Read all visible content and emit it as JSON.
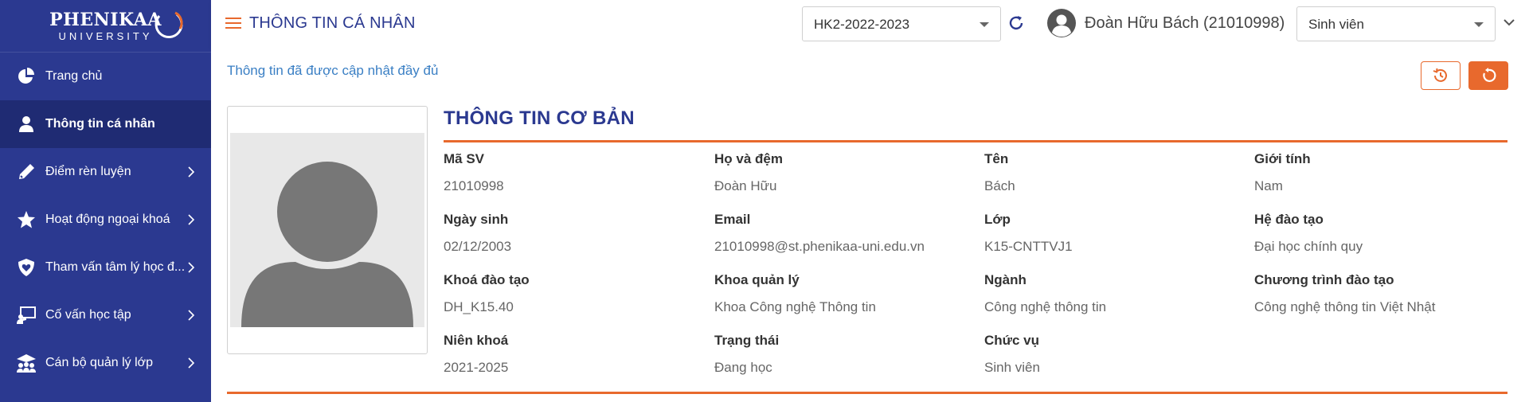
{
  "brand": {
    "name": "PHENIKAA",
    "sub": "UNIVERSITY"
  },
  "colors": {
    "primary": "#2b3990",
    "accent": "#e8692d",
    "link": "#3a7fc4"
  },
  "sidebar": {
    "items": [
      {
        "label": "Trang chủ",
        "icon": "pie-chart-icon",
        "active": false,
        "chevron": false
      },
      {
        "label": "Thông tin cá nhân",
        "icon": "user-icon",
        "active": true,
        "chevron": false
      },
      {
        "label": "Điểm rèn luyện",
        "icon": "pencil-icon",
        "active": false,
        "chevron": true
      },
      {
        "label": "Hoạt động ngoại khoá",
        "icon": "star-icon",
        "active": false,
        "chevron": true
      },
      {
        "label": "Tham vấn tâm lý học đ...",
        "icon": "shield-heart-icon",
        "active": false,
        "chevron": true
      },
      {
        "label": "Cố vấn học tập",
        "icon": "teacher-board-icon",
        "active": false,
        "chevron": true
      },
      {
        "label": "Cán bộ quản lý lớp",
        "icon": "group-icon",
        "active": false,
        "chevron": true
      }
    ]
  },
  "header": {
    "title": "THÔNG TIN CÁ NHÂN",
    "semester": "HK2-2022-2023",
    "user": "Đoàn Hữu Bách (21010998)",
    "role": "Sinh viên"
  },
  "main": {
    "notice": "Thông tin đã được cập nhật đầy đủ",
    "section_title": "THÔNG TIN CƠ BẢN",
    "fields": [
      {
        "label": "Mã SV",
        "value": "21010998"
      },
      {
        "label": "Họ và đệm",
        "value": "Đoàn Hữu"
      },
      {
        "label": "Tên",
        "value": "Bách"
      },
      {
        "label": "Giới tính",
        "value": "Nam"
      },
      {
        "label": "Ngày sinh",
        "value": "02/12/2003"
      },
      {
        "label": "Email",
        "value": "21010998@st.phenikaa-uni.edu.vn"
      },
      {
        "label": "Lớp",
        "value": "K15-CNTTVJ1"
      },
      {
        "label": "Hệ đào tạo",
        "value": "Đại học chính quy"
      },
      {
        "label": "Khoá đào tạo",
        "value": "DH_K15.40"
      },
      {
        "label": "Khoa quản lý",
        "value": "Khoa Công nghệ Thông tin"
      },
      {
        "label": "Ngành",
        "value": "Công nghệ thông tin"
      },
      {
        "label": "Chương trình đào tạo",
        "value": "Công nghệ thông tin Việt Nhật"
      },
      {
        "label": "Niên khoá",
        "value": "2021-2025"
      },
      {
        "label": "Trạng thái",
        "value": "Đang học"
      },
      {
        "label": "Chức vụ",
        "value": "Sinh viên"
      }
    ]
  }
}
